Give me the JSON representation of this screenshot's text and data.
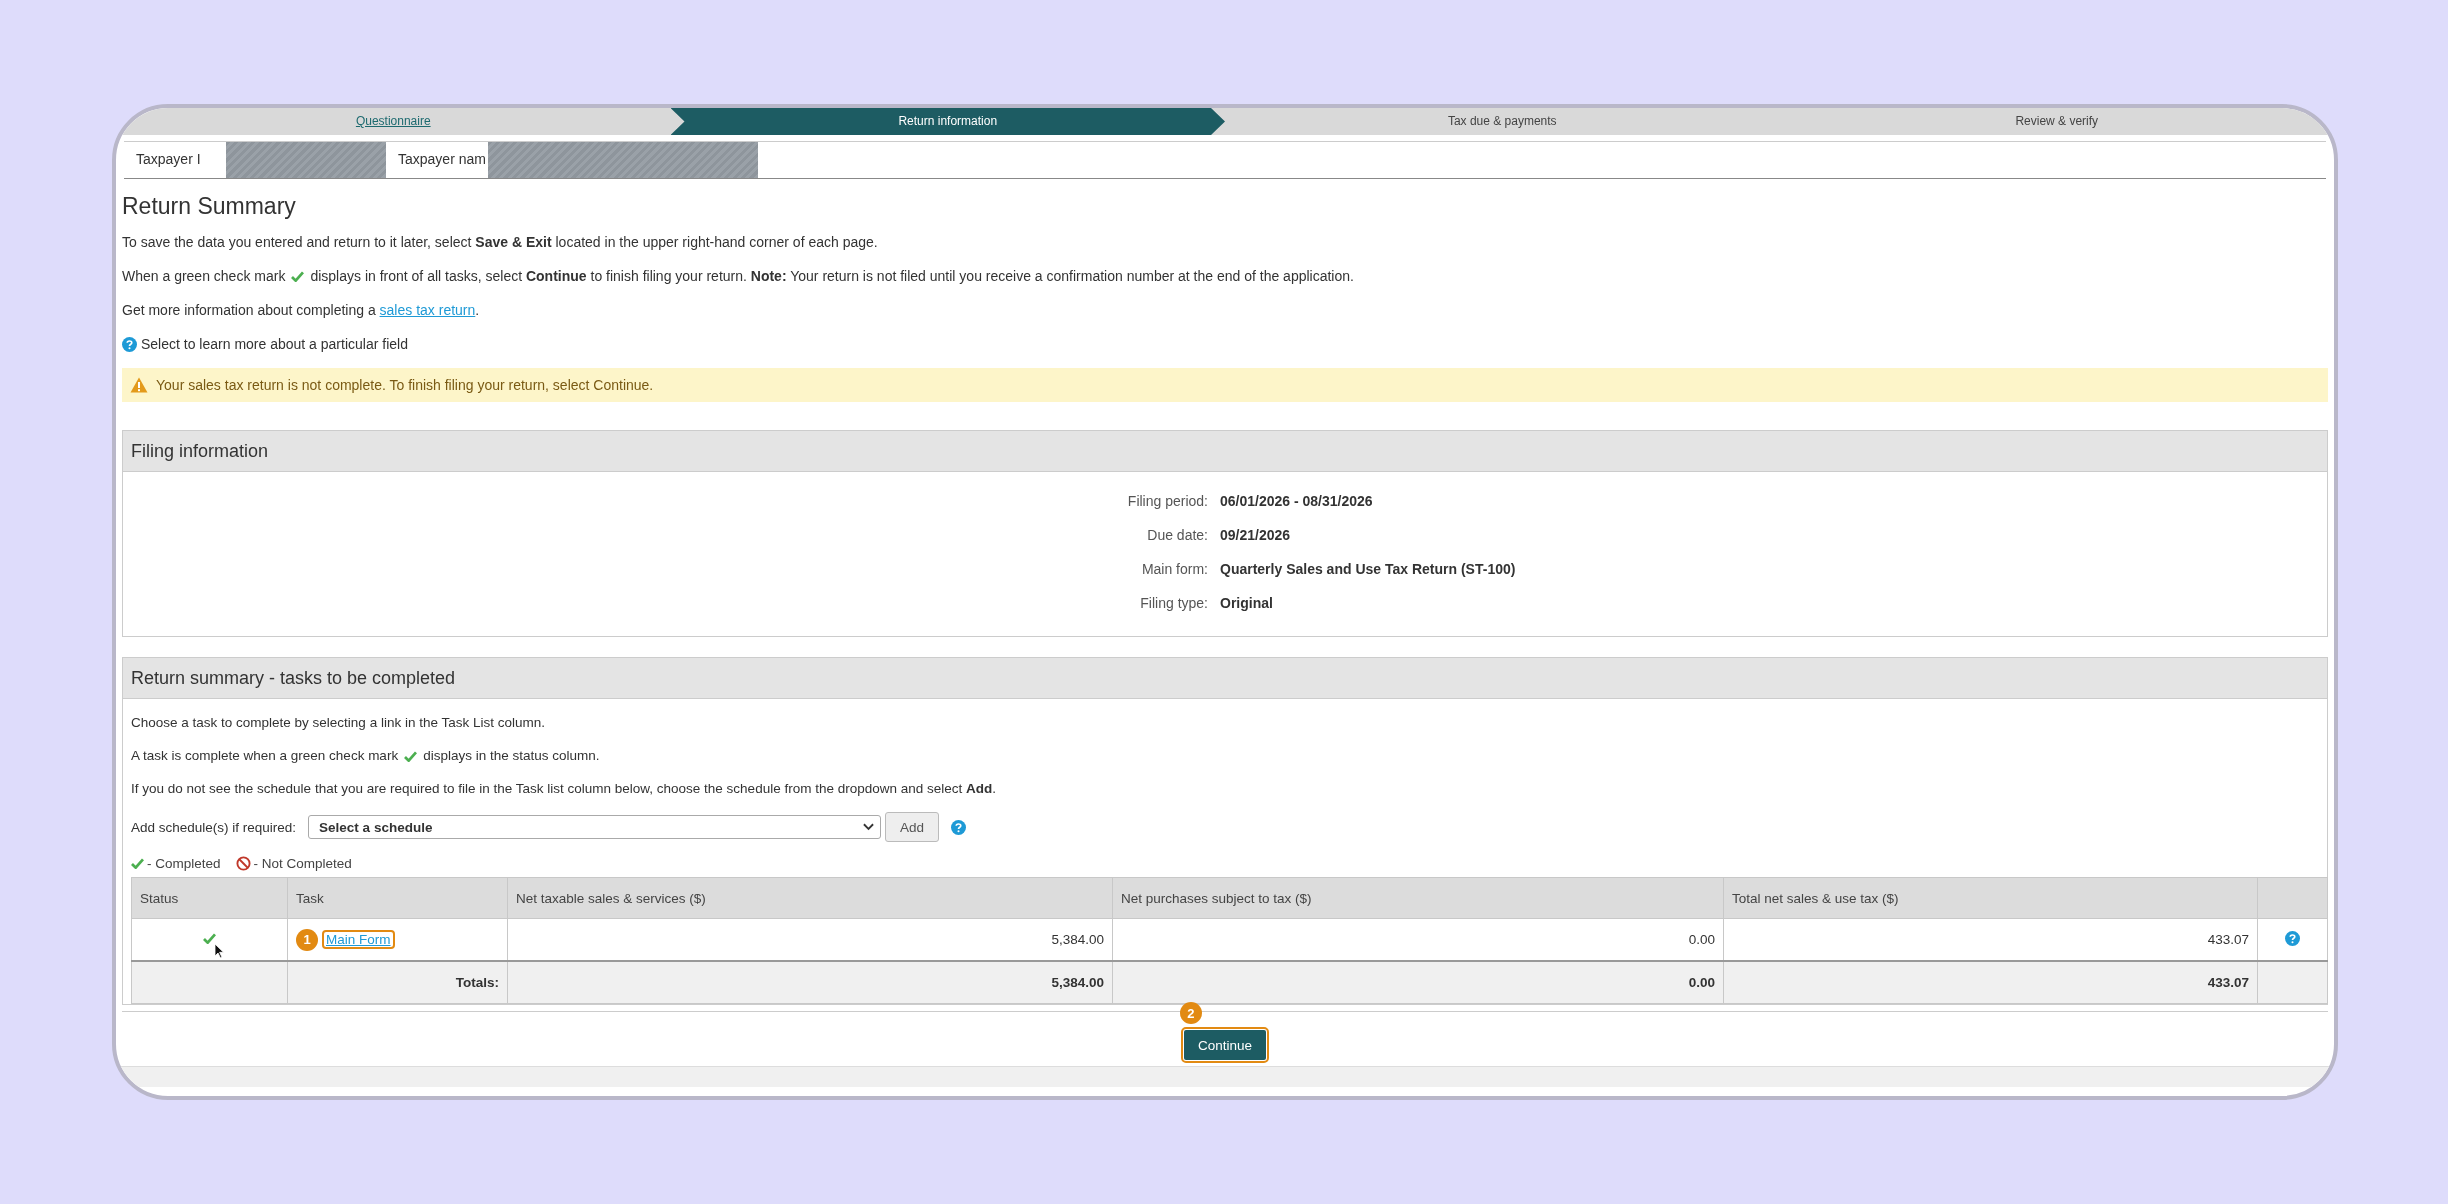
{
  "steps": [
    {
      "label": "Questionnaire",
      "completed": true,
      "selected": false
    },
    {
      "label": "Return information",
      "completed": false,
      "selected": true
    },
    {
      "label": "Tax due & payments",
      "completed": false,
      "selected": false
    },
    {
      "label": "Review & verify",
      "completed": false,
      "selected": false
    }
  ],
  "taxpayer": [
    {
      "label": "Taxpayer I"
    },
    {
      "label": "Taxpayer nam"
    }
  ],
  "title": "Return Summary",
  "intro": {
    "save": "To save the data you entered and return to it later, select **Save & Exit** located in the upper right-hand corner of each page.",
    "check_before": "When a green check mark",
    "check_after": "displays in front of all tasks, select **Continue** to finish filing your return. **Note:** Your return is not filed until you receive a confirmation number at the end of the application.",
    "more_before": "Get more information about completing a",
    "more_link": "sales tax return",
    "more_after": ".",
    "help": "Select to learn more about a particular field"
  },
  "warning": "Your sales tax return is not complete. To finish filing your return, select Continue.",
  "filing": {
    "title": "Filing information",
    "fields": [
      {
        "label": "Filing period:",
        "value": "06/01/2026 - 08/31/2026"
      },
      {
        "label": "Due date:",
        "value": "09/21/2026"
      },
      {
        "label": "Main form:",
        "value": "Quarterly Sales and Use Tax Return (ST-100)"
      },
      {
        "label": "Filing type:",
        "value": "Original"
      }
    ]
  },
  "tasks": {
    "title": "Return summary - tasks to be completed",
    "line1": "Choose a task to complete by selecting a link in the Task List column.",
    "line2_before": "A task is complete when a green check mark",
    "line2_after": "displays in the status column.",
    "line3": "If you do not see the schedule that you are required to file in the Task list column below, choose the schedule from the dropdown and select **Add**.",
    "add_label": "Add schedule(s) if required:",
    "select_value": "Select a schedule",
    "add_button": "Add",
    "legend": [
      {
        "completed": true,
        "label": "- Completed"
      },
      {
        "completed": false,
        "label": "- Not Completed"
      }
    ],
    "columns": [
      "Status",
      "Task",
      "Net taxable sales & services ($)",
      "Net purchases subject to tax ($)",
      "Total net sales & use tax ($)"
    ],
    "rows": [
      {
        "completed": true,
        "task": "Main Form",
        "callout": "1",
        "net_taxable": "5,384.00",
        "net_purchases": "0.00",
        "total": "433.07"
      }
    ],
    "totals": {
      "label": "Totals:",
      "net_taxable": "5,384.00",
      "net_purchases": "0.00",
      "total": "433.07"
    }
  },
  "continue": {
    "label": "Continue",
    "callout": "2"
  }
}
